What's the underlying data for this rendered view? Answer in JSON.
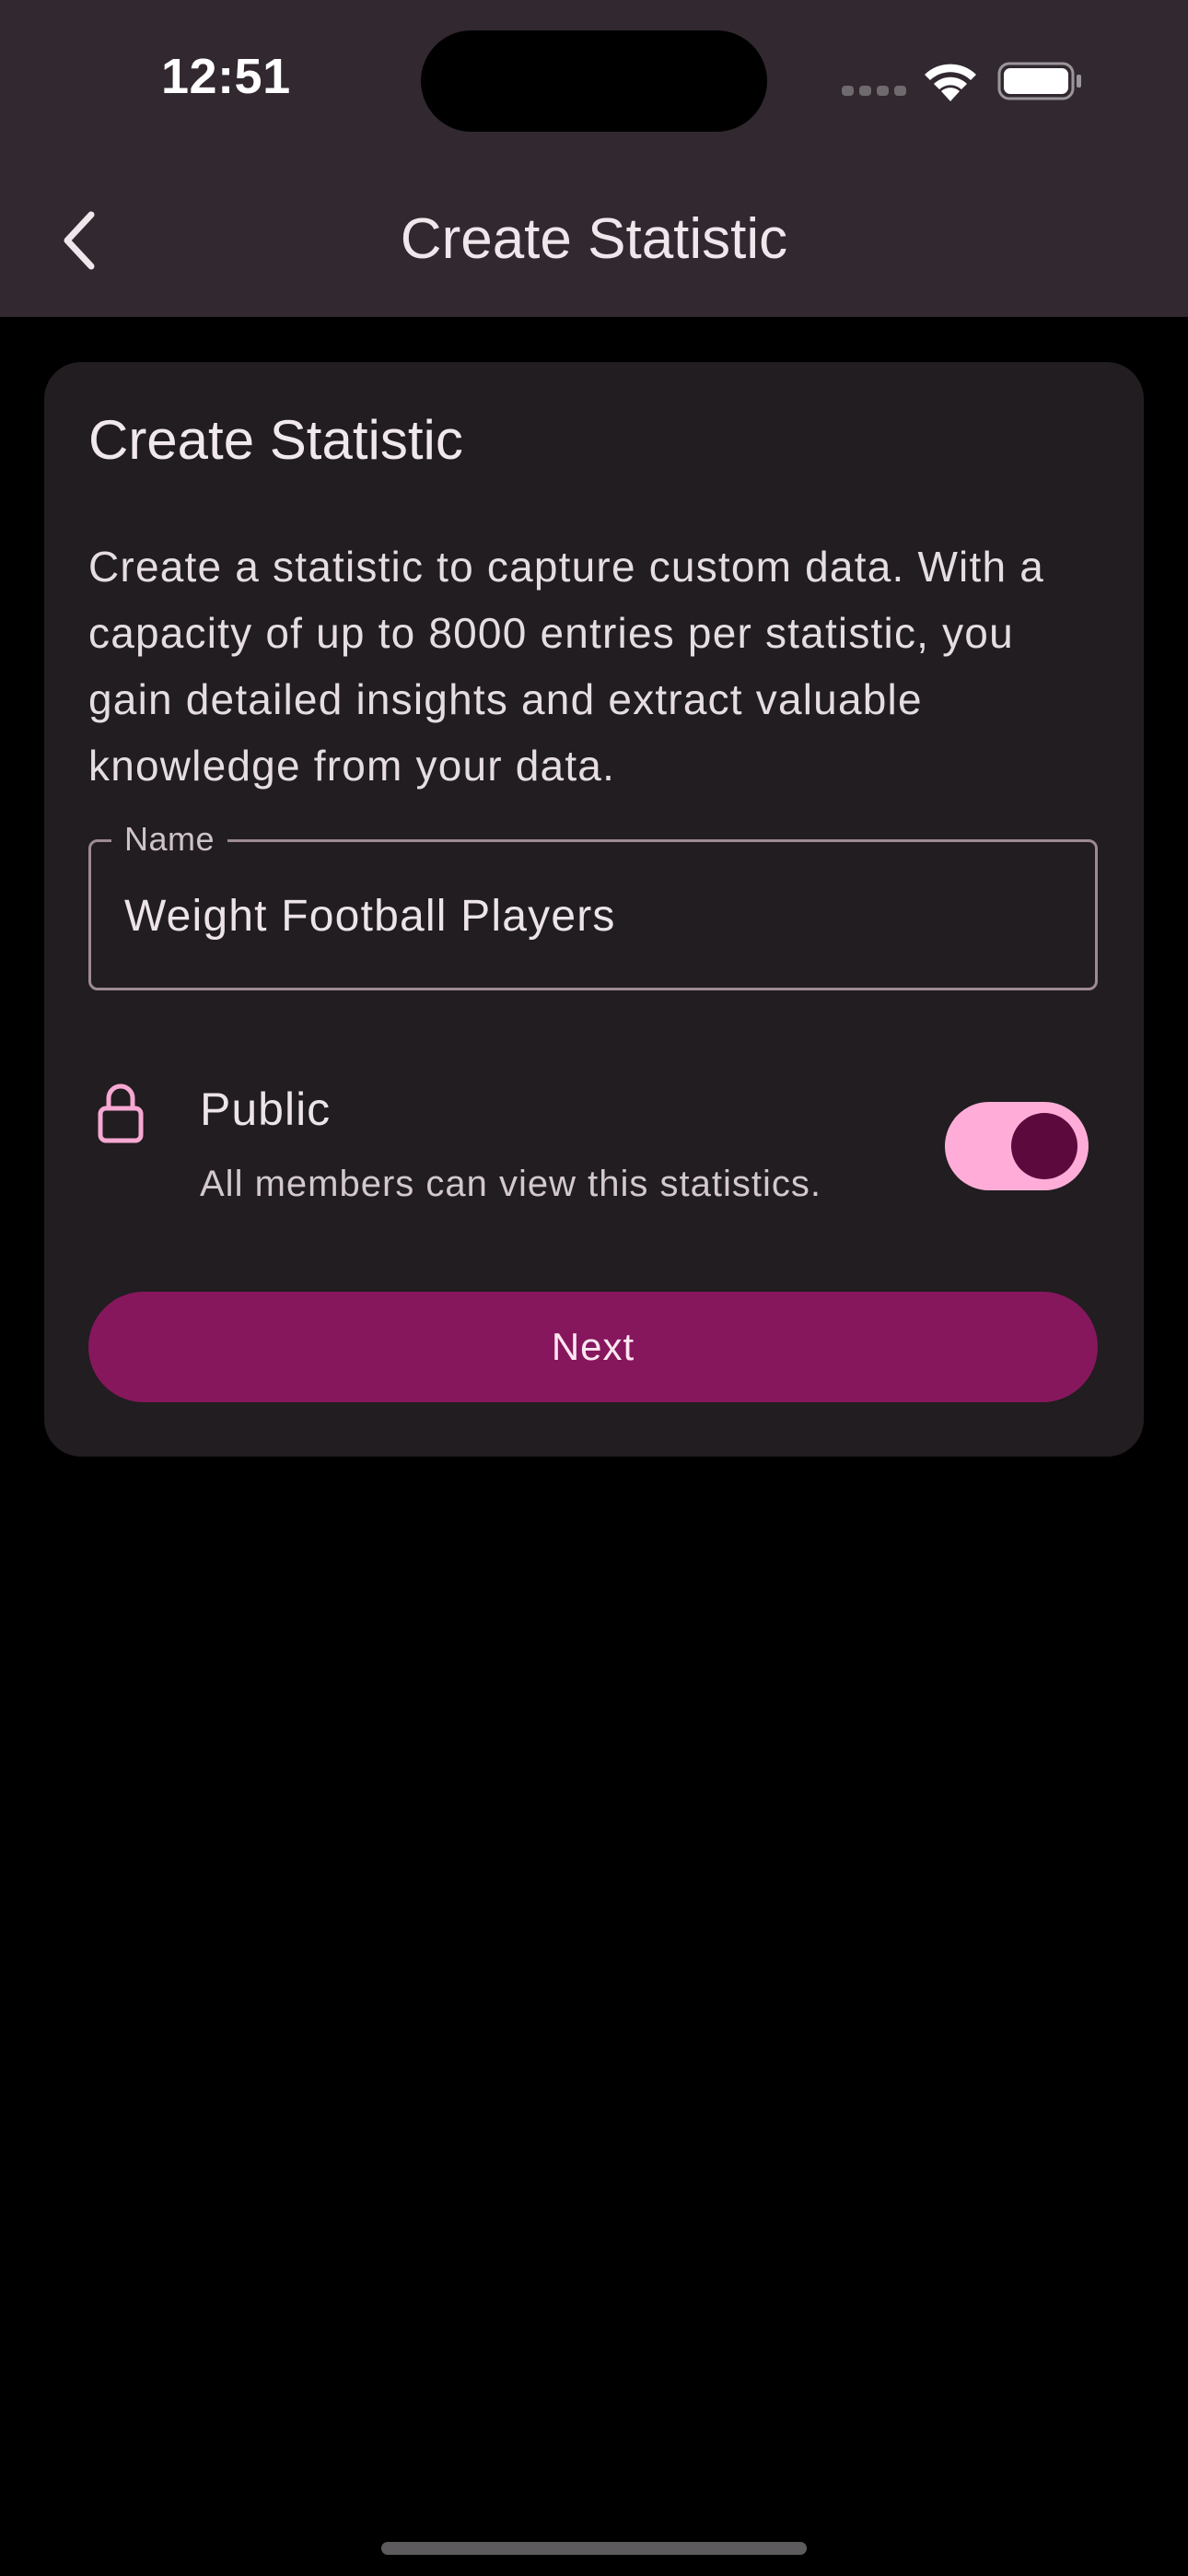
{
  "status_bar": {
    "time": "12:51"
  },
  "app_bar": {
    "title": "Create Statistic",
    "back_icon": "chevron-left-icon"
  },
  "card": {
    "title": "Create Statistic",
    "description": "Create a statistic to capture custom data. With a capacity of up to 8000 entries per statistic, you gain detailed insights and extract valuable knowledge from your data.",
    "name_field": {
      "label": "Name",
      "value": "Weight Football Players"
    },
    "public_option": {
      "icon": "lock-icon",
      "title": "Public",
      "subtitle": "All members can view this statistics.",
      "enabled": true
    },
    "next_button": {
      "label": "Next"
    }
  },
  "colors": {
    "app_bar_bg": "#322830",
    "card_bg": "#211d20",
    "accent": "#86175d",
    "toggle_track": "#ffadd8",
    "toggle_knob": "#5c0a3e",
    "lock_icon": "#f7a8d2"
  }
}
